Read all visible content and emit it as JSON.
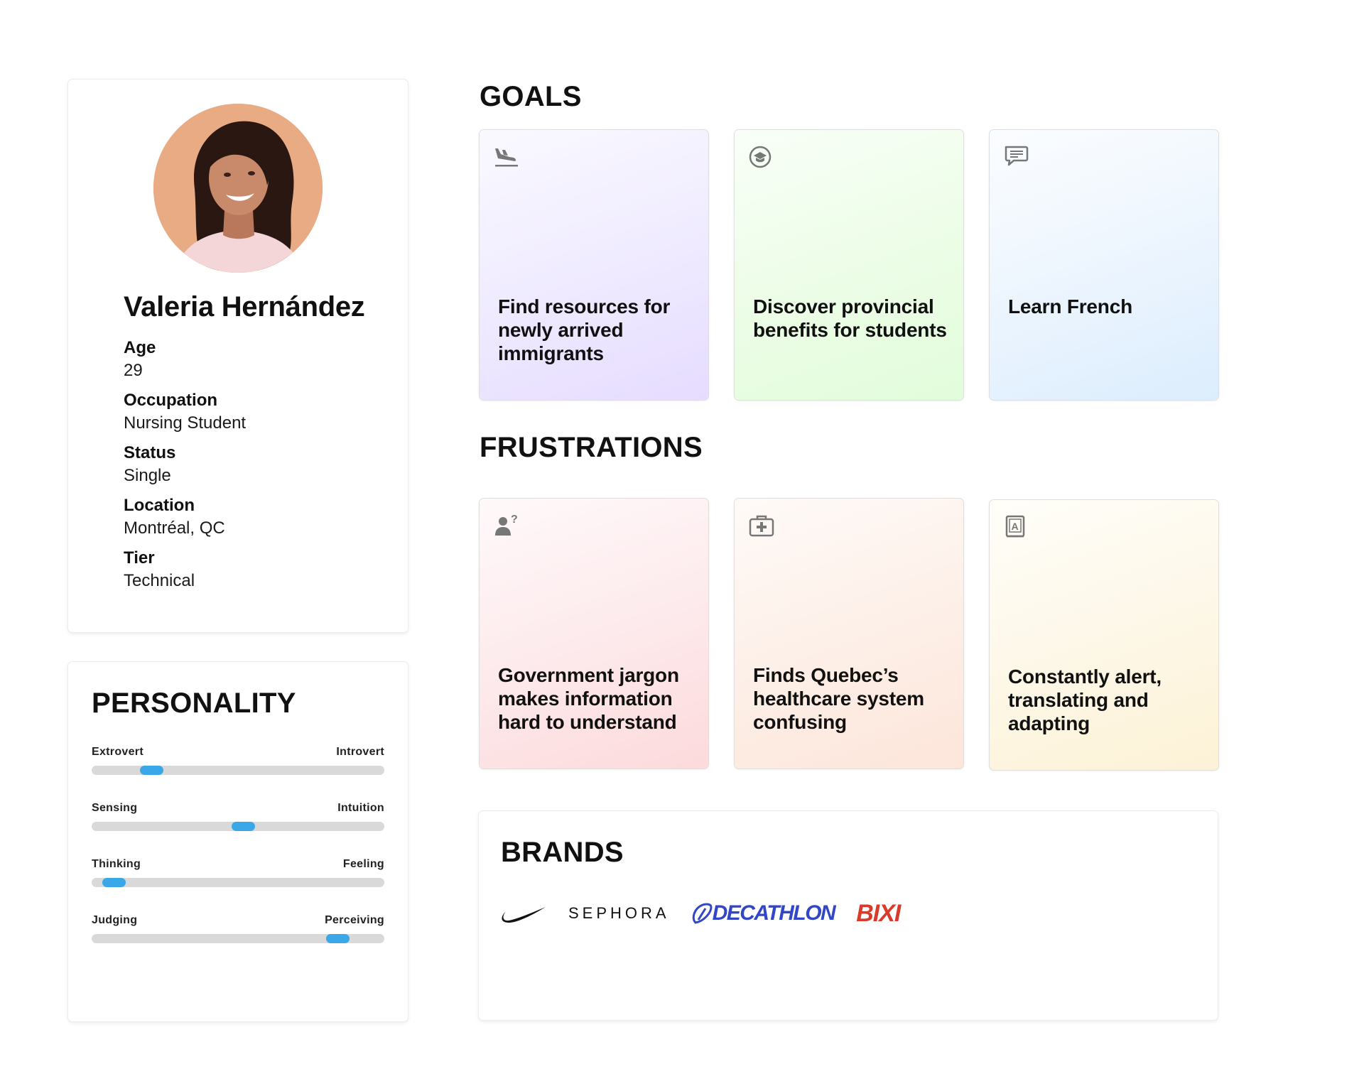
{
  "profile": {
    "name": "Valeria Hernández",
    "attributes": [
      {
        "label": "Age",
        "value": "29"
      },
      {
        "label": "Occupation",
        "value": "Nursing Student"
      },
      {
        "label": "Status",
        "value": "Single"
      },
      {
        "label": "Location",
        "value": "Montréal, QC"
      },
      {
        "label": "Tier",
        "value": "Technical"
      }
    ]
  },
  "personality": {
    "title": "PERSONALITY",
    "traits": [
      {
        "left": "Extrovert",
        "right": "Introvert",
        "level": 0.18
      },
      {
        "left": "Sensing",
        "right": "Intuition",
        "level": 0.52
      },
      {
        "left": "Thinking",
        "right": "Feeling",
        "level": 0.04
      },
      {
        "left": "Judging",
        "right": "Perceiving",
        "level": 0.87
      }
    ],
    "accent": "#3aa7e8"
  },
  "goals": {
    "title": "GOALS",
    "items": [
      {
        "icon": "plane-landing-icon",
        "text": "Find resources for newly arrived immigrants"
      },
      {
        "icon": "graduation-cap-icon",
        "text": "Discover provincial benefits for students"
      },
      {
        "icon": "chat-bubble-icon",
        "text": "Learn French"
      }
    ]
  },
  "frustrations": {
    "title": "FRUSTRATIONS",
    "items": [
      {
        "icon": "person-question-icon",
        "text": "Government jargon makes information hard to understand"
      },
      {
        "icon": "medical-kit-icon",
        "text": "Finds Quebec’s healthcare system confusing"
      },
      {
        "icon": "translate-book-icon",
        "text": "Constantly alert, translating and adapting"
      }
    ]
  },
  "brands": {
    "title": "BRANDS",
    "items": [
      "nike-logo",
      "SEPHORA",
      "DECATHLON",
      "BIXI"
    ]
  }
}
